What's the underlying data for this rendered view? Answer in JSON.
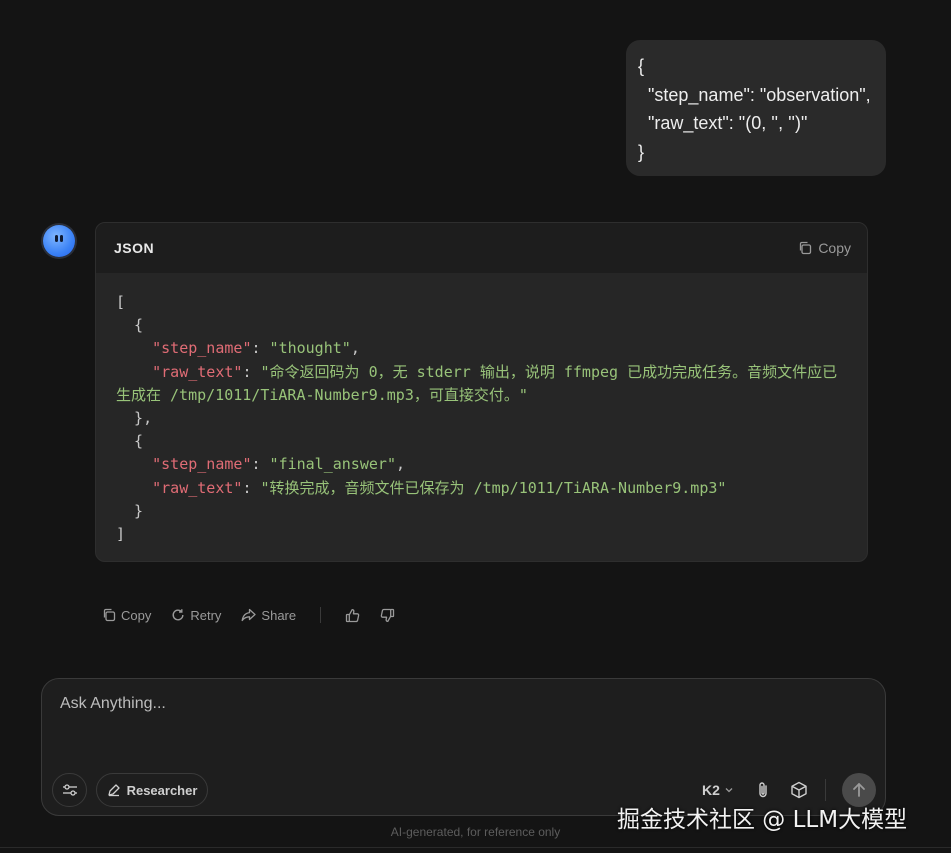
{
  "user_message": {
    "lines": [
      "{",
      "  \"step_name\": \"observation\",",
      "  \"raw_text\": \"(0, '', '')\"",
      "}"
    ]
  },
  "assistant": {
    "code_lang": "JSON",
    "copy_label": "Copy",
    "code": {
      "l1": "[",
      "l2": "  {",
      "l3_key": "step_name",
      "l3_val": "thought",
      "l4_key": "raw_text",
      "l4_val": "命令返回码为 0，无 stderr 输出，说明 ffmpeg 已成功完成任务。音频文件应已生成在 /tmp/1011/TiARA-Number9.mp3，可直接交付。",
      "l5": "  },",
      "l6": "  {",
      "l7_key": "step_name",
      "l7_val": "final_answer",
      "l8_key": "raw_text",
      "l8_val": "转换完成，音频文件已保存为 /tmp/1011/TiARA-Number9.mp3",
      "l9": "  }",
      "l10": "]"
    }
  },
  "actions": {
    "copy": "Copy",
    "retry": "Retry",
    "share": "Share"
  },
  "input": {
    "placeholder": "Ask Anything...",
    "researcher_label": "Researcher",
    "model": "K2"
  },
  "footer": {
    "disclaimer": "AI-generated, for reference only",
    "watermark": "掘金技术社区 @ LLM大模型"
  },
  "colors": {
    "background": "#141414",
    "json_key": "#e06c75",
    "json_string": "#98c379"
  }
}
